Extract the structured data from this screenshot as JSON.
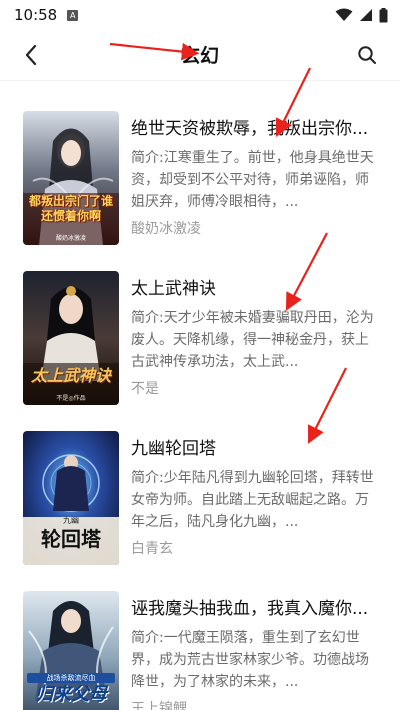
{
  "status_bar": {
    "time": "10:58",
    "app_icon": "A"
  },
  "header": {
    "title": "玄幻",
    "back_icon": "back-arrow-icon",
    "search_icon": "search-icon"
  },
  "books": [
    {
      "title": "绝世天资被欺辱，我叛出宗你...",
      "desc": "简介:江寒重生了。前世，他身具绝世天资，却受到不公平对待，师弟诬陷，师姐厌弃，师傅冷眼相待，...",
      "author": "酸奶冰激凌",
      "cover_text": "都叛出宗门了谁还惯着你啊",
      "cover_sub": "酸奶冰激凌"
    },
    {
      "title": "太上武神诀",
      "desc": "简介:天才少年被未婚妻骗取丹田，沦为废人。天降机缘，得一神秘金丹，获上古武神传承功法，太上武...",
      "author": "不是",
      "cover_text": "太上武神诀",
      "cover_sub": "不是◎作品"
    },
    {
      "title": "九幽轮回塔",
      "desc": "简介:少年陆凡得到九幽轮回塔，拜转世女帝为师。自此踏上无敌崛起之路。万年之后，陆凡身化九幽，...",
      "author": "白青玄",
      "cover_text": "轮回塔",
      "cover_sub": "九幽"
    },
    {
      "title": "诬我魔头抽我血，我真入魔你...",
      "desc": "简介:一代魔王陨落，重生到了玄幻世界，成为荒古世家林家少爷。功德战场降世，为了林家的未来，...",
      "author": "王上锦鲤",
      "cover_text": "归来父母",
      "cover_sub": "战场杀敌流尽血"
    }
  ]
}
